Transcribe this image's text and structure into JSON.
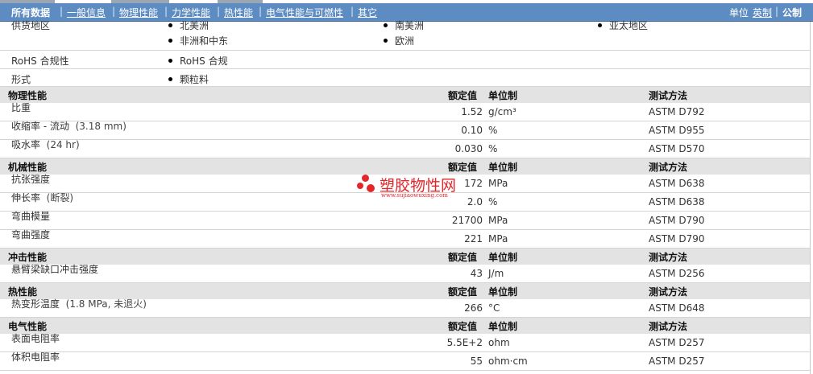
{
  "nav": {
    "tabs": [
      "所有数据",
      "一般信息",
      "物理性能",
      "力学性能",
      "热性能",
      "电气性能与可燃性",
      "其它"
    ],
    "separator": "|",
    "units_label": "单位",
    "unit_english": "英制",
    "unit_metric": "公制"
  },
  "general": {
    "regions_label": "供货地区",
    "regions": [
      "北美洲",
      "南美洲",
      "亚太地区",
      "非洲和中东",
      "欧洲"
    ],
    "rohs_label": "RoHS 合规性",
    "rohs_value": "RoHS 合规",
    "form_label": "形式",
    "form_value": "颗粒料"
  },
  "headers": {
    "nominal": "额定值",
    "unit": "单位制",
    "test": "测试方法"
  },
  "sections": [
    {
      "title": "物理性能",
      "rows": [
        {
          "label": "比重",
          "note": "",
          "value": "1.52",
          "unit": "g/cm³",
          "test": "ASTM D792"
        },
        {
          "label": "收缩率 - 流动",
          "note": "(3.18 mm)",
          "value": "0.10",
          "unit": "%",
          "test": "ASTM D955"
        },
        {
          "label": "吸水率",
          "note": "(24 hr)",
          "value": "0.030",
          "unit": "%",
          "test": "ASTM D570"
        }
      ]
    },
    {
      "title": "机械性能",
      "rows": [
        {
          "label": "抗张强度",
          "note": "",
          "value": "172",
          "unit": "MPa",
          "test": "ASTM D638"
        },
        {
          "label": "伸长率",
          "note": "(断裂)",
          "value": "2.0",
          "unit": "%",
          "test": "ASTM D638"
        },
        {
          "label": "弯曲模量",
          "note": "",
          "value": "21700",
          "unit": "MPa",
          "test": "ASTM D790"
        },
        {
          "label": "弯曲强度",
          "note": "",
          "value": "221",
          "unit": "MPa",
          "test": "ASTM D790"
        }
      ]
    },
    {
      "title": "冲击性能",
      "rows": [
        {
          "label": "悬臂梁缺口冲击强度",
          "note": "",
          "value": "43",
          "unit": "J/m",
          "test": "ASTM D256"
        }
      ]
    },
    {
      "title": "热性能",
      "rows": [
        {
          "label": "热变形温度",
          "note": "(1.8 MPa, 未退火)",
          "value": "266",
          "unit": "°C",
          "test": "ASTM D648"
        }
      ]
    },
    {
      "title": "电气性能",
      "rows": [
        {
          "label": "表面电阻率",
          "note": "",
          "value": "5.5E+2",
          "unit": "ohm",
          "test": "ASTM D257"
        },
        {
          "label": "体积电阻率",
          "note": "",
          "value": "55",
          "unit": "ohm·cm",
          "test": "ASTM D257"
        }
      ]
    }
  ],
  "watermark": {
    "name": "塑胶物性网",
    "url": "www.sujiaowuxing.com"
  }
}
